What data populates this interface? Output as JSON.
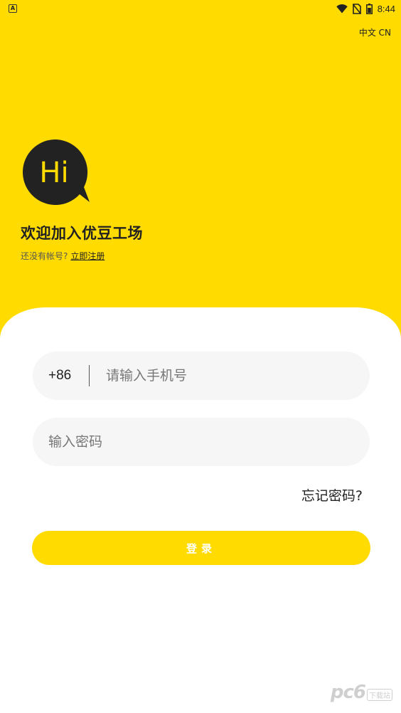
{
  "status_bar": {
    "notification_icon": "A",
    "time": "8:44",
    "icons": [
      "wifi-icon",
      "no-sim-icon",
      "battery-icon"
    ]
  },
  "language": {
    "label": "中文 CN"
  },
  "logo": {
    "text": "Hi",
    "bubble_color": "#222222",
    "text_color": "#FFDB00"
  },
  "welcome": {
    "title": "欢迎加入优豆工场",
    "no_account_text": "还没有帐号?",
    "register_link": "立即注册"
  },
  "form": {
    "country_code": "+86",
    "phone_placeholder": "请输入手机号",
    "phone_value": "",
    "password_placeholder": "输入密码",
    "password_value": "",
    "forgot_password": "忘记密码?",
    "login_button": "登录"
  },
  "watermark": {
    "main": "pc6",
    "sub": "下载站"
  },
  "colors": {
    "brand_yellow": "#FFDB00",
    "panel_bg": "#FFFFFF",
    "field_bg": "#F6F6F6",
    "text_dark": "#222222"
  }
}
